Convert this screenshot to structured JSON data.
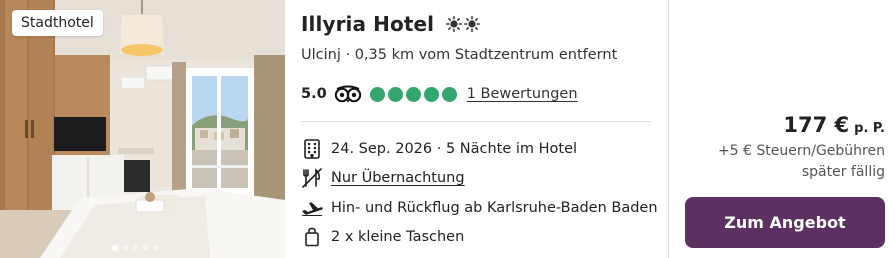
{
  "photo": {
    "badge": "Stadthotel",
    "slide_count": 5,
    "active_slide": 1
  },
  "hotel": {
    "name": "Illyria Hotel",
    "sun_rating": 2,
    "location": "Ulcinj · 0,35 km vom Stadtzentrum entfernt",
    "rating_value": "5.0",
    "rating_bubbles": 5,
    "reviews_label": "1 Bewertungen"
  },
  "features": {
    "dates": "24. Sep. 2026 · 5 Nächte im Hotel",
    "board": "Nur Übernachtung",
    "flight": "Hin- und Rückflug ab Karlsruhe-Baden Baden",
    "luggage": "2 x kleine Taschen"
  },
  "price": {
    "amount": "177 €",
    "per_person": "p. P.",
    "fees_line1": "+5 € Steuern/Gebühren",
    "fees_line2": "später fällig",
    "cta_label": "Zum Angebot"
  },
  "colors": {
    "cta": "#5c3060",
    "rating_green": "#34a56f"
  },
  "icons": [
    "sun-icon",
    "tripadvisor-icon",
    "hotel-building-icon",
    "no-food-icon",
    "airplane-icon",
    "bag-icon"
  ]
}
